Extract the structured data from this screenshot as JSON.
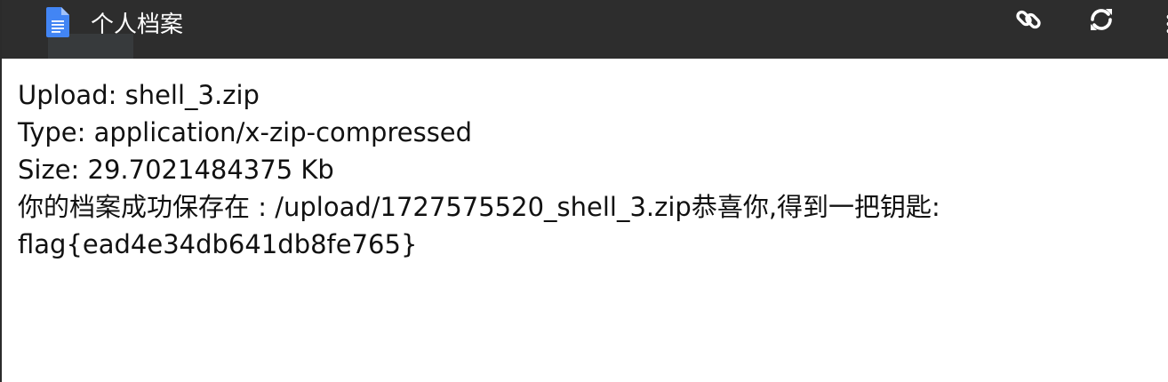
{
  "window": {
    "title": "个人档案",
    "icons": {
      "app": "google-docs-icon",
      "link": "link-icon",
      "refresh": "refresh-icon",
      "more": "more-vert-icon"
    },
    "colors": {
      "topbar": "#2d2d2d",
      "docs_blue": "#4285f4"
    }
  },
  "content": {
    "lines": [
      "Upload: shell_3.zip",
      "Type: application/x-zip-compressed",
      "Size: 29.7021484375 Kb",
      "你的档案成功保存在 : /upload/1727575520_shell_3.zip恭喜你,得到一把钥匙:",
      "flag{ead4e34db641db8fe765}"
    ]
  }
}
